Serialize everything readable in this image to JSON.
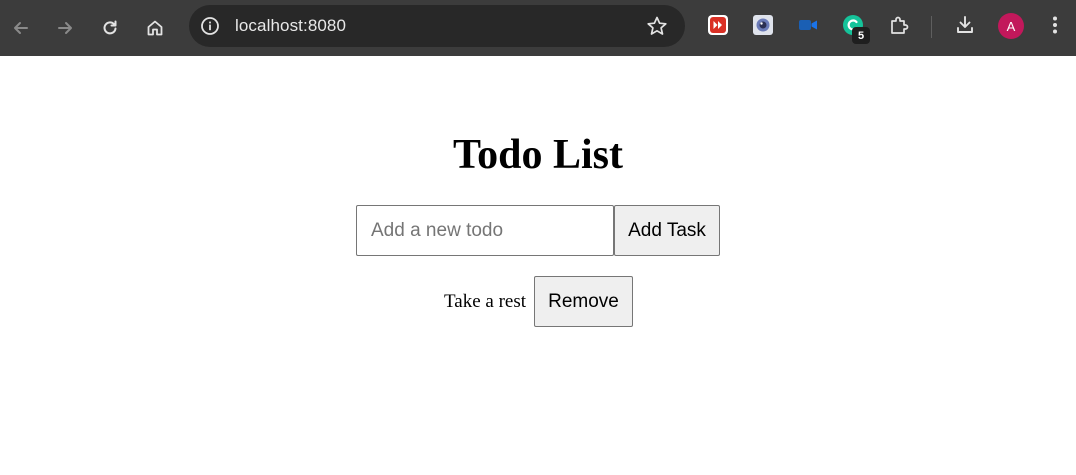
{
  "browser": {
    "url": "localhost:8080",
    "icons": {
      "back": "arrow-left-icon",
      "forward": "arrow-right-icon",
      "reload": "reload-icon",
      "home": "home-icon",
      "site_info": "info-icon",
      "bookmark": "star-icon",
      "extensions": "puzzle-icon",
      "downloads": "download-icon",
      "menu": "kebab-menu-icon"
    },
    "extensions": [
      {
        "name": "red-forward-extension-icon",
        "color": "#d93025"
      },
      {
        "name": "camera-lens-extension-icon",
        "color": "#6b7bb8"
      },
      {
        "name": "video-camera-extension-icon",
        "color": "#1a73e8"
      },
      {
        "name": "green-c-extension-icon",
        "color": "#15c39a"
      }
    ],
    "extension_badge": "5",
    "profile_initial": "A",
    "profile_color": "#c2185b",
    "toolbar_color": "#3c3c3c",
    "omnibox_color": "#282828"
  },
  "app": {
    "title": "Todo List",
    "input_placeholder": "Add a new todo",
    "input_value": "",
    "add_button_label": "Add Task",
    "todos": [
      {
        "text": "Take a rest",
        "remove_label": "Remove"
      }
    ]
  }
}
